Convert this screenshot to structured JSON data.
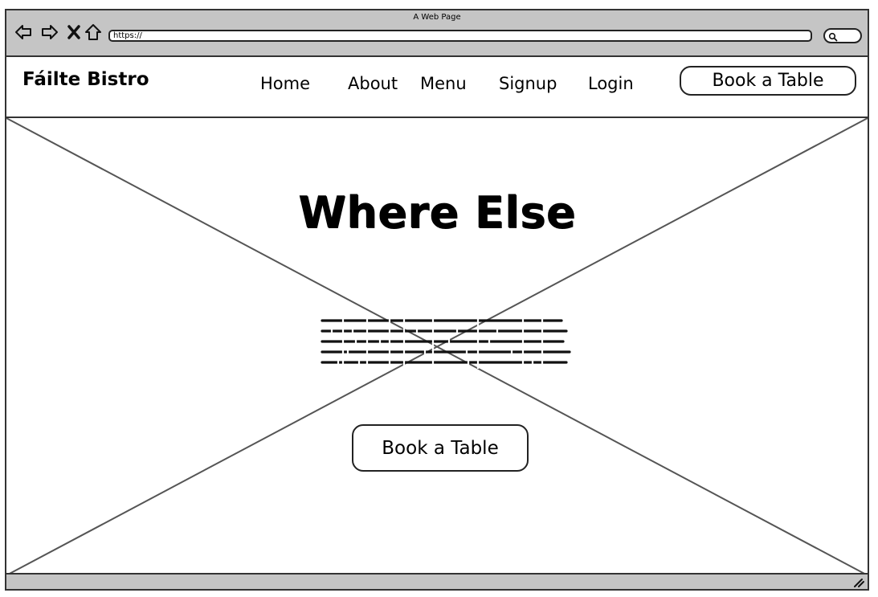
{
  "window": {
    "title": "A Web Page"
  },
  "toolbar": {
    "back_icon": "back-arrow-icon",
    "forward_icon": "forward-arrow-icon",
    "stop_icon": "close-icon",
    "home_icon": "home-icon",
    "url": "https://",
    "search_icon": "search-icon"
  },
  "header": {
    "brand": "Fáilte Bistro",
    "nav": [
      {
        "label": "Home"
      },
      {
        "label": "About"
      },
      {
        "label": "Menu"
      },
      {
        "label": "Signup"
      },
      {
        "label": "Login"
      }
    ],
    "cta_label": "Book a Table"
  },
  "hero": {
    "image_placeholder": "image-placeholder",
    "title": "Where Else",
    "cta_label": "Book a Table"
  },
  "colors": {
    "chrome": "#c5c5c5",
    "border": "#333333"
  }
}
